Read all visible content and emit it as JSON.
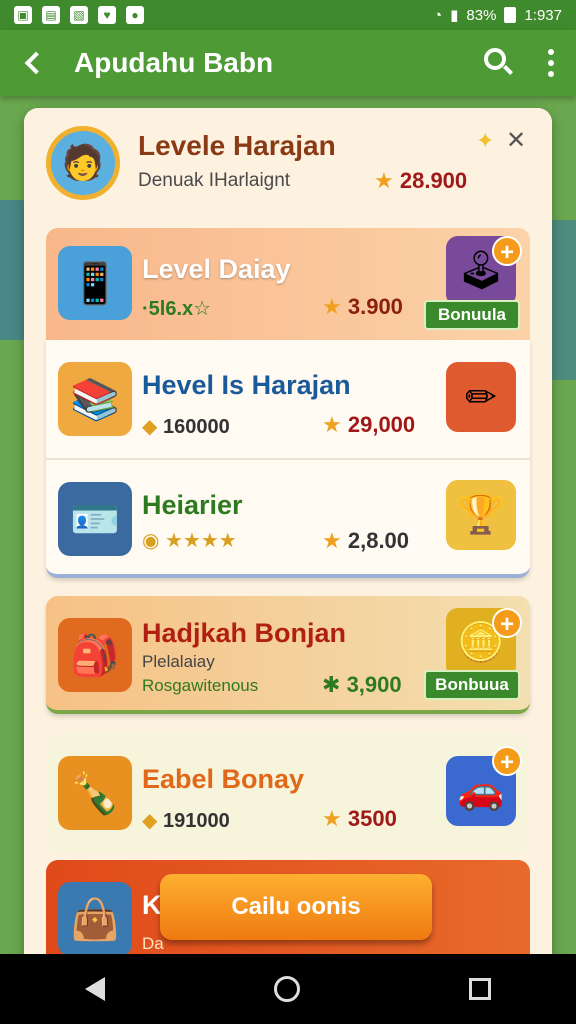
{
  "status_bar": {
    "battery": "83%",
    "time": "1:937"
  },
  "app_bar": {
    "title": "Apudahu Babn"
  },
  "profile": {
    "name": "Levele Harajan",
    "subtitle": "Denuak IHarlaignt",
    "score": "28.900"
  },
  "rows": [
    {
      "title": "Level Daiay",
      "meta": "·5l6.x☆",
      "score": "3.900",
      "button": "Bonuula"
    },
    {
      "title": "Hevel Is Harajan",
      "meta": "160000",
      "score": "29,000"
    },
    {
      "title": "Heiarier",
      "meta": "★★★★",
      "score": "2,8.00"
    },
    {
      "title": "Hadjkah Bonjan",
      "sub1": "Plelalaiay",
      "sub2": "Rosgawitenous",
      "score": "3,900",
      "button": "Bonbuua"
    },
    {
      "title": "Eabel Bonay",
      "meta": "191000",
      "score": "3500"
    },
    {
      "title": "K",
      "sub": "Da"
    }
  ],
  "cta": {
    "label": "Cailu oonis"
  },
  "colors": {
    "accent": "#4e9a35",
    "cta": "#f49b1a"
  }
}
